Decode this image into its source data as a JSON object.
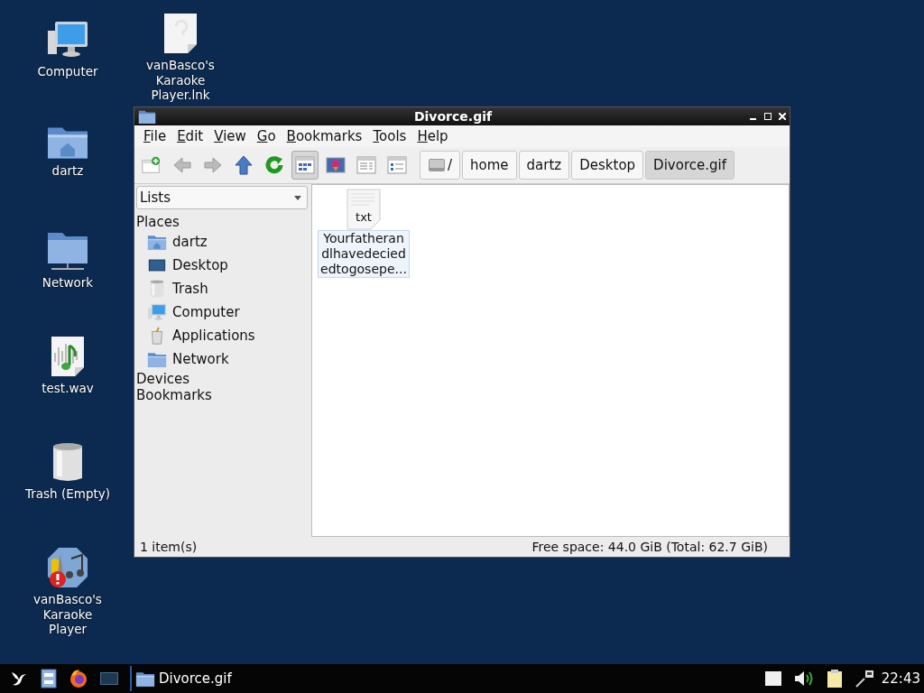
{
  "desktop_icons": [
    {
      "label": "Computer",
      "kind": "computer"
    },
    {
      "label": "vanBasco's Karaoke Player.lnk",
      "kind": "unknown"
    },
    {
      "label": "dartz",
      "kind": "home"
    },
    {
      "label": "Network",
      "kind": "network"
    },
    {
      "label": "test.wav",
      "kind": "audio"
    },
    {
      "label": "Trash (Empty)",
      "kind": "trash"
    },
    {
      "label": "vanBasco's Karaoke Player",
      "kind": "app"
    }
  ],
  "window": {
    "title": "Divorce.gif",
    "menu": [
      "File",
      "Edit",
      "View",
      "Go",
      "Bookmarks",
      "Tools",
      "Help"
    ],
    "view_modes": [
      {
        "kind": "icons",
        "selected": true
      },
      {
        "kind": "thumbnails",
        "selected": false
      },
      {
        "kind": "compact",
        "selected": false
      },
      {
        "kind": "details",
        "selected": false
      }
    ],
    "path_bar": [
      {
        "label": "/",
        "kind": "drive",
        "selected": false
      },
      {
        "label": "home",
        "kind": "folder",
        "selected": false
      },
      {
        "label": "dartz",
        "kind": "folder",
        "selected": false
      },
      {
        "label": "Desktop",
        "kind": "folder",
        "selected": false
      },
      {
        "label": "Divorce.gif",
        "kind": "folder",
        "selected": true
      }
    ],
    "side_pane": {
      "mode": "Lists",
      "sections": [
        {
          "label": "Places",
          "items": [
            {
              "label": "dartz",
              "kind": "home"
            },
            {
              "label": "Desktop",
              "kind": "desktop"
            },
            {
              "label": "Trash",
              "kind": "trash"
            },
            {
              "label": "Computer",
              "kind": "computer"
            },
            {
              "label": "Applications",
              "kind": "applications"
            },
            {
              "label": "Network",
              "kind": "network"
            }
          ]
        },
        {
          "label": "Devices"
        },
        {
          "label": "Bookmarks"
        }
      ]
    },
    "files": [
      {
        "label": "Yourfatheran dlhavedecied edtogosepe...",
        "badge": "txt"
      }
    ],
    "status_bar": {
      "left": "1 item(s)",
      "right": "Free space: 44.0 GiB (Total: 62.7 GiB)"
    }
  },
  "taskbar": {
    "launchers": [
      {
        "kind": "menu"
      },
      {
        "kind": "files"
      },
      {
        "kind": "browser"
      },
      {
        "kind": "terminal"
      }
    ],
    "tasks": [
      {
        "label": "Divorce.gif"
      }
    ],
    "tray": [
      {
        "kind": "drive"
      },
      {
        "kind": "volume"
      },
      {
        "kind": "clipboard"
      },
      {
        "kind": "network"
      }
    ],
    "clock": "22:43"
  }
}
